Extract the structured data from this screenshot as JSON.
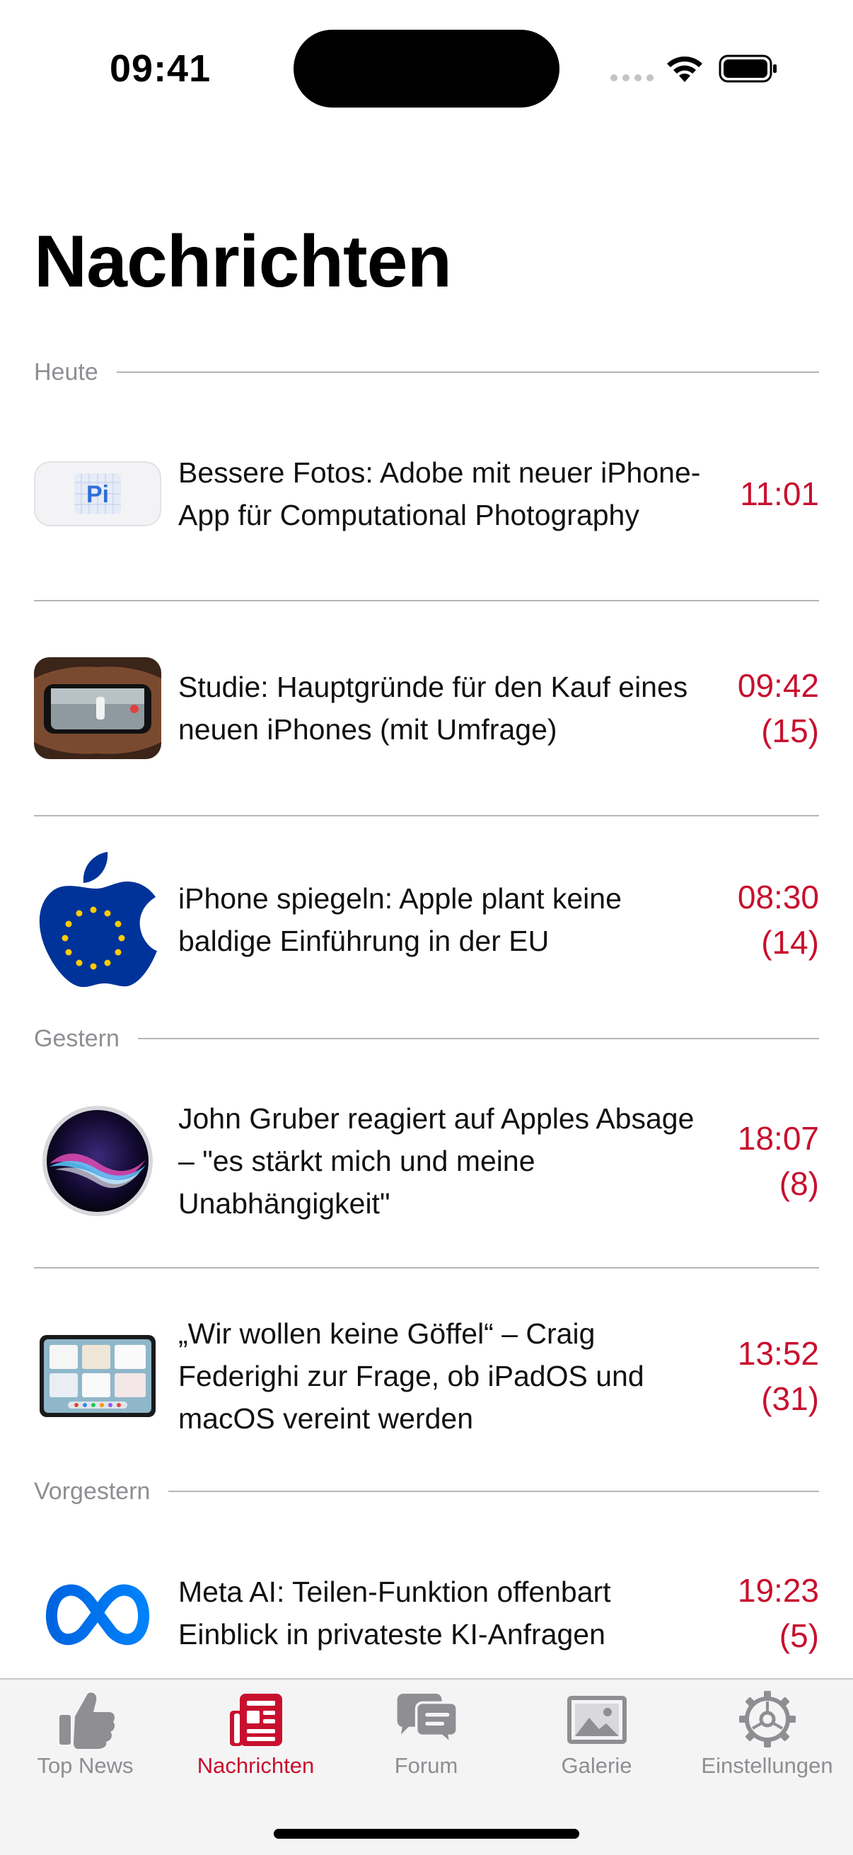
{
  "status_bar": {
    "time": "09:41"
  },
  "title": "Nachrichten",
  "sections": [
    {
      "label": "Heute",
      "items": [
        {
          "headline": "Bessere Fotos: Adobe mit neuer iPhone-App für Computational Photography",
          "time": "11:01",
          "comments": "",
          "thumbnail": "adobe-project-indigo-app-icon",
          "thumb_text": "Pi"
        },
        {
          "headline": "Studie: Hauptgründe für den Kauf eines neuen iPhones (mit Umfrage)",
          "time": "09:42",
          "comments": "(15)",
          "thumbnail": "iphone-in-hands-photo"
        },
        {
          "headline": "iPhone spiegeln: Apple plant keine baldige Einführung in der EU",
          "time": "08:30",
          "comments": "(14)",
          "thumbnail": "apple-logo-eu-flag"
        }
      ]
    },
    {
      "label": "Gestern",
      "items": [
        {
          "headline": "John Gruber reagiert auf Apples Absage – \"es stärkt mich und meine Unabhängigkeit\"",
          "time": "18:07",
          "comments": "(8)",
          "thumbnail": "siri-orb-icon"
        },
        {
          "headline": "„Wir wollen keine Göffel“ – Craig Federighi zur Frage, ob iPadOS und macOS vereint werden",
          "time": "13:52",
          "comments": "(31)",
          "thumbnail": "ipad-screen-photo"
        }
      ]
    },
    {
      "label": "Vorgestern",
      "items": [
        {
          "headline": "Meta AI: Teilen-Funktion offenbart Einblick in privateste KI-Anfragen",
          "time": "19:23",
          "comments": "(5)",
          "thumbnail": "meta-logo"
        }
      ]
    }
  ],
  "tabs": [
    {
      "label": "Top News",
      "icon": "thumbs-up-icon",
      "active": false
    },
    {
      "label": "Nachrichten",
      "icon": "newspaper-icon",
      "active": true
    },
    {
      "label": "Forum",
      "icon": "chat-bubbles-icon",
      "active": false
    },
    {
      "label": "Galerie",
      "icon": "photo-icon",
      "active": false
    },
    {
      "label": "Einstellungen",
      "icon": "gear-icon",
      "active": false
    }
  ],
  "colors": {
    "accent": "#c8102e",
    "secondary_text": "#8e8e93",
    "divider": "#b5b5b9",
    "tab_bar_bg": "#f4f4f5"
  }
}
